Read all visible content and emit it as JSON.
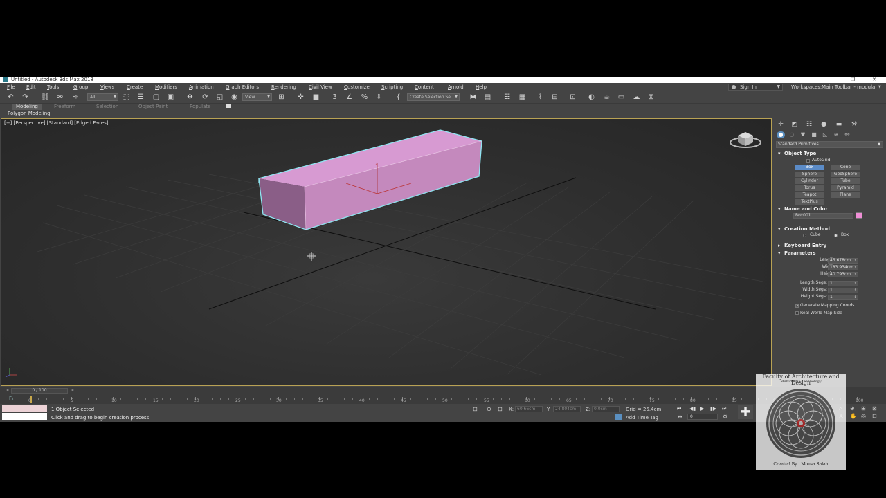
{
  "window": {
    "title": "Untitled - Autodesk 3ds Max 2018"
  },
  "menu": {
    "items": [
      "File",
      "Edit",
      "Tools",
      "Group",
      "Views",
      "Create",
      "Modifiers",
      "Animation",
      "Graph Editors",
      "Rendering",
      "Civil View",
      "Customize",
      "Scripting",
      "Content",
      "Arnold",
      "Help"
    ],
    "sign_in": "Sign In",
    "workspaces_label": "Workspaces:",
    "workspaces_value": "Main Toolbar - modular"
  },
  "toolbar": {
    "selection_filter": "All",
    "reference_coord": "View",
    "named_selection_placeholder": "Create Selection Se"
  },
  "ribbon": {
    "tabs": [
      "Modeling",
      "Freeform",
      "Selection",
      "Object Paint",
      "Populate"
    ],
    "active_tab": "Modeling",
    "sub_label": "Polygon Modeling"
  },
  "viewport": {
    "label": "[+] [Perspective] [Standard] [Edged Faces]",
    "object_color": "#d98bcf",
    "selection_color": "#7fe0f0"
  },
  "command_panel": {
    "category_dropdown": "Standard Primitives",
    "object_type": {
      "title": "Object Type",
      "autogrid_label": "AutoGrid",
      "buttons": [
        "Box",
        "Cone",
        "Sphere",
        "GeoSphere",
        "Cylinder",
        "Tube",
        "Torus",
        "Pyramid",
        "Teapot",
        "Plane",
        "TextPlus"
      ],
      "active_button": "Box"
    },
    "name_and_color": {
      "title": "Name and Color",
      "name_value": "Box001",
      "color": "#f08ed6"
    },
    "creation_method": {
      "title": "Creation Method",
      "options": [
        "Cube",
        "Box"
      ],
      "selected": "Box"
    },
    "keyboard_entry": {
      "title": "Keyboard Entry"
    },
    "parameters": {
      "title": "Parameters",
      "length_label": "Length:",
      "length_value": "45.678cm",
      "width_label": "Width:",
      "width_value": "183.934cm",
      "height_label": "Height:",
      "height_value": "40.793cm",
      "length_segs_label": "Length Segs:",
      "length_segs_value": "1",
      "width_segs_label": "Width Segs:",
      "width_segs_value": "1",
      "height_segs_label": "Height Segs:",
      "height_segs_value": "1",
      "gen_mapping_label": "Generate Mapping Coords.",
      "gen_mapping_checked": true,
      "real_world_label": "Real-World Map Size",
      "real_world_checked": false
    }
  },
  "timeline": {
    "slider_label": "0 / 100",
    "frame_labels": [
      "0",
      "5",
      "10",
      "15",
      "20",
      "25",
      "30",
      "35",
      "40",
      "45",
      "50",
      "55",
      "60",
      "65",
      "70",
      "75",
      "80",
      "85",
      "90",
      "95",
      "100"
    ]
  },
  "status": {
    "selection_text": "1 Object Selected",
    "prompt_text": "Click and drag to begin creation process",
    "x_label": "X:",
    "x_value": "60.66cm",
    "y_label": "Y:",
    "y_value": "24.804cm",
    "z_label": "Z:",
    "z_value": "0.0cm",
    "grid_text": "Grid = 25.4cm",
    "add_time_tag": "Add Time Tag",
    "current_frame": "0"
  },
  "watermark": {
    "title": "Faculty of Architecture and Design",
    "subtitle": "Multimedia Technology",
    "credit": "Created By : Mousa Salah"
  }
}
